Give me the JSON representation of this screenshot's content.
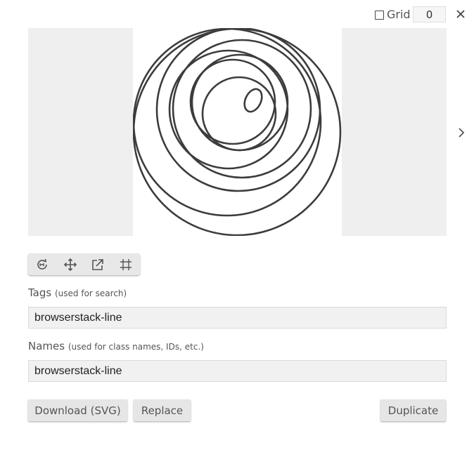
{
  "grid": {
    "label": "Grid",
    "checked": false,
    "size_value": "0"
  },
  "icons": {
    "close": "close-icon",
    "next": "chevron-right-icon",
    "rotate": "rotate-icon",
    "move": "move-icon",
    "resize": "resize-icon",
    "crop": "crop-icon"
  },
  "preview": {
    "icon_name": "browserstack-line"
  },
  "tags": {
    "label": "Tags",
    "hint": "(used for search)",
    "value": "browserstack-line"
  },
  "names": {
    "label": "Names",
    "hint": "(used for class names, IDs, etc.)",
    "value": "browserstack-line"
  },
  "buttons": {
    "download": "Download (SVG)",
    "replace": "Replace",
    "duplicate": "Duplicate"
  },
  "colors": {
    "icon_stroke": "#3c3c3c",
    "pane_background": "#efefef",
    "button_background": "#e6e6e6"
  }
}
